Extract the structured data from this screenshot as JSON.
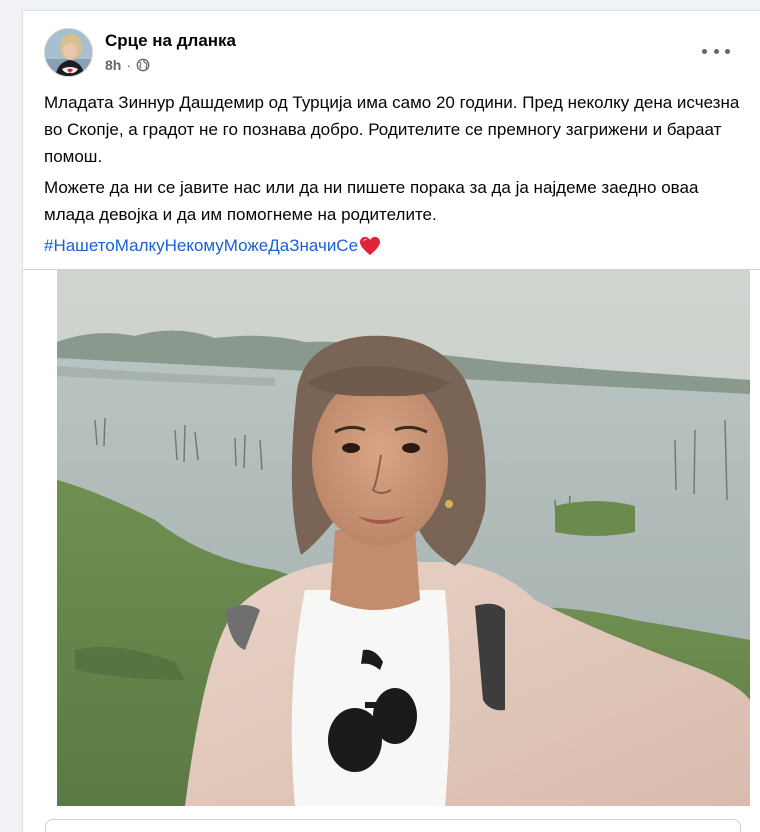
{
  "post": {
    "author": "Срце на дланка",
    "time": "8h",
    "audience_icon": "globe-icon",
    "menu_icon": "more-options-icon",
    "paragraph1": "Младата Зиннур Дашдемир од Турција има само 20 години. Пред неколку дена исчезна во Скопје, а градот не го познава добро. Родителите се премногу загрижени и бараат помош.",
    "paragraph2": "Можете да ни се јавите нас или да ни пишете порака за да ја најдеме заедно оваа млада девојка и да им помогнеме на родителите.",
    "hashtag": "#НашетоМалкуНекомуМожеДаЗначиСе",
    "hashtag_emoji": "red-heart-icon",
    "photo": "selfie of young woman by a lake"
  },
  "colors": {
    "link": "#1b5fd6",
    "text": "#050505",
    "secondary_text": "#65676b",
    "page_background": "#f0f2f5",
    "card_background": "#ffffff"
  }
}
